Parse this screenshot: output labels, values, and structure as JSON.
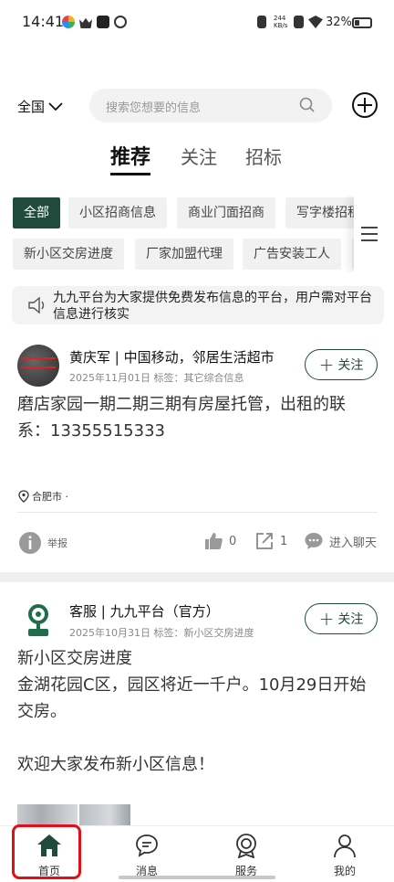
{
  "status_bar": {
    "time": "14:41",
    "net_speed": "244\nKB/s",
    "battery": "32%",
    "battery_level": 0.32
  },
  "header": {
    "region": "全国",
    "search_placeholder": "搜索您想要的信息"
  },
  "tabs": [
    "推荐",
    "关注",
    "招标"
  ],
  "chips_row1": [
    "全部",
    "小区招商信息",
    "商业门面招商",
    "写字楼招租"
  ],
  "chips_row2": [
    "新小区交房进度",
    "厂家加盟代理",
    "广告安装工人",
    "…"
  ],
  "notice": "九九平台为大家提供免费发布信息的平台，用户需对平台信息进行核实",
  "post1": {
    "author": "黄庆军 | 中国移动，邻居生活超市",
    "meta": "2025年11月01日 标签：其它综合信息",
    "follow": "关注",
    "body": "磨店家园一期二期三期有房屋托管，出租的联系：13355515333",
    "location": "合肥市 ·",
    "report": "举报",
    "likes": "0",
    "shares": "1",
    "chat": "进入聊天"
  },
  "post2": {
    "author": "客服 | 九九平台（官方）",
    "meta": "2025年10月31日 标签：新小区交房进度",
    "follow": "关注",
    "body": "新小区交房进度\n金湖花园C区，园区将近一千户。10月29日开始交房。\n\n欢迎大家发布新小区信息！"
  },
  "nav": {
    "home": "首页",
    "messages": "消息",
    "service": "服务",
    "mine": "我的"
  },
  "colors": {
    "accent": "#1f4a3c",
    "highlight": "#e0101b"
  }
}
